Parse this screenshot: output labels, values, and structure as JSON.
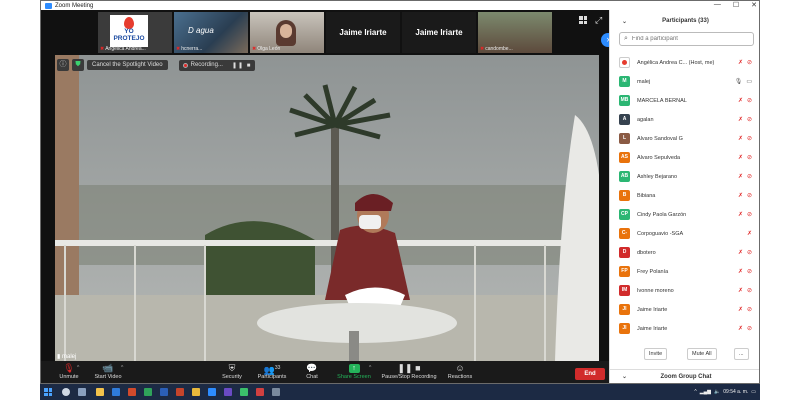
{
  "window": {
    "title": "Zoom Meeting",
    "controls": [
      "—",
      "☐",
      "✕"
    ]
  },
  "thumbnails": [
    {
      "name": "Angélica Andrea...",
      "kind": "logo",
      "logo_text": "YO PROTEJO"
    },
    {
      "name": "hcnerra...",
      "kind": "video",
      "overlay_text": "D agua"
    },
    {
      "name": "Olga León",
      "kind": "video"
    },
    {
      "name": "Jaime Iriarte",
      "kind": "text"
    },
    {
      "name": "Jaime Iriarte",
      "kind": "text"
    },
    {
      "name": "candombe...",
      "kind": "video"
    }
  ],
  "spotlight": {
    "cancel_label": "Cancel the Spotlight Video",
    "recording_label": "Recording...",
    "video_name": "malej"
  },
  "toolbar": {
    "unmute": "Unmute",
    "start_video": "Start Video",
    "security": "Security",
    "participants": "Participants",
    "participants_count": "33",
    "chat": "Chat",
    "share_screen": "Share Screen",
    "record": "Pause/Stop Recording",
    "reactions": "Reactions",
    "end": "End"
  },
  "participants_panel": {
    "title": "Participants (33)",
    "search_placeholder": "Find a participant",
    "invite": "Invite",
    "mute_all": "Mute All",
    "more": "...",
    "chat_title": "Zoom Group Chat",
    "items": [
      {
        "initials": "",
        "name": "Angélica Andrea C... (Host, me)",
        "color": "#ffffff",
        "logo": true
      },
      {
        "initials": "M",
        "name": "malej",
        "color": "#2bb673",
        "mic": "on"
      },
      {
        "initials": "MB",
        "name": "MARCELA BERNAL",
        "color": "#2bb673"
      },
      {
        "initials": "A",
        "name": "agalan",
        "color": "#36424f"
      },
      {
        "initials": "L",
        "name": "Alvaro Sandoval G",
        "color": "#8a5a44"
      },
      {
        "initials": "AS",
        "name": "Alvaro Sepulveda",
        "color": "#e9730c"
      },
      {
        "initials": "AB",
        "name": "Ashley Bejarano",
        "color": "#2bb673"
      },
      {
        "initials": "B",
        "name": "Bibiana",
        "color": "#e9730c"
      },
      {
        "initials": "CP",
        "name": "Cindy Paola Garzón",
        "color": "#2bb673"
      },
      {
        "initials": "C-",
        "name": "Corpoguavio -SGA",
        "color": "#e9730c",
        "novideo": true
      },
      {
        "initials": "D",
        "name": "dbotero",
        "color": "#d12b2b"
      },
      {
        "initials": "FP",
        "name": "Frey Polanía",
        "color": "#e9730c"
      },
      {
        "initials": "IM",
        "name": "Ivonne moreno",
        "color": "#d12b2b"
      },
      {
        "initials": "JI",
        "name": "Jaime Iriarte",
        "color": "#e9730c"
      },
      {
        "initials": "JI",
        "name": "Jaime Iriarte",
        "color": "#e9730c"
      }
    ]
  },
  "taskbar": {
    "time": "09:54 a. m."
  }
}
